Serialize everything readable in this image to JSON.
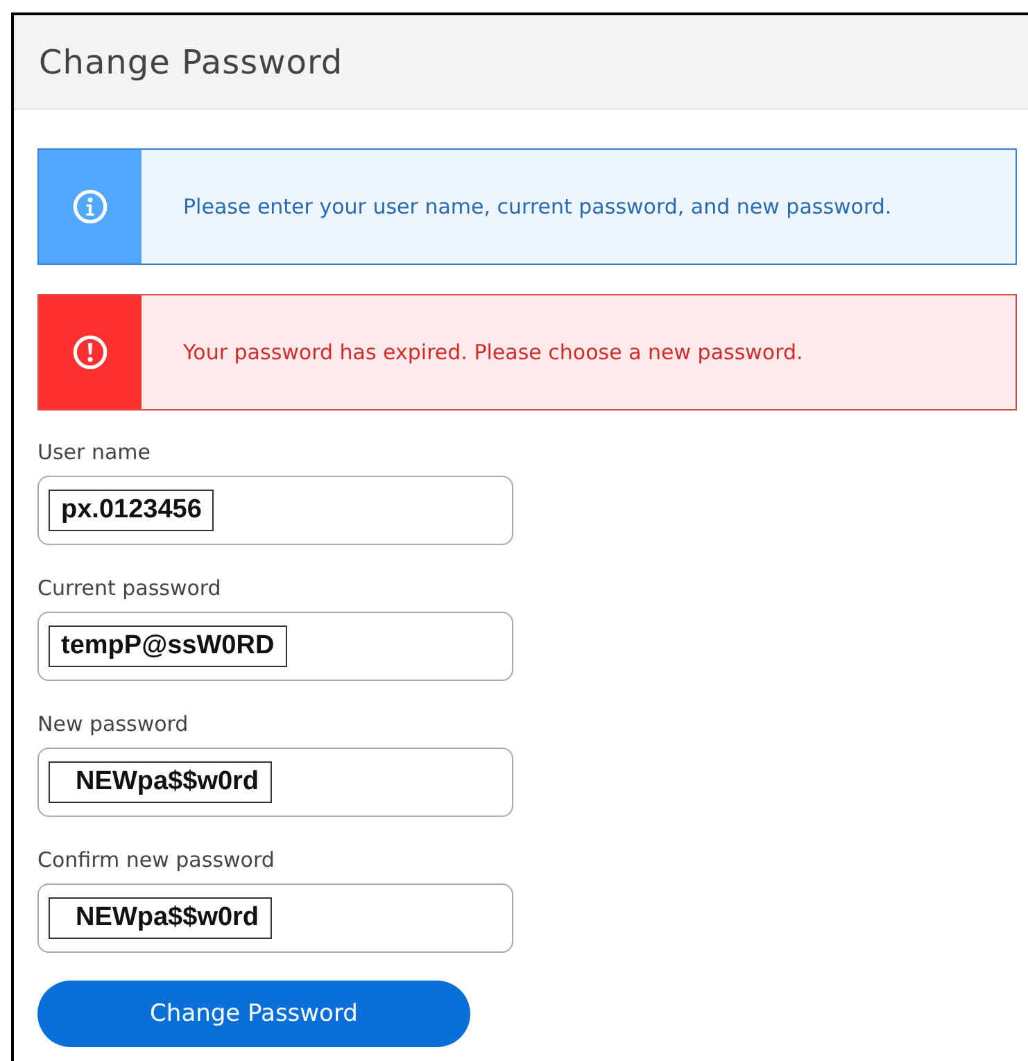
{
  "window": {
    "title": "Change Password"
  },
  "alerts": [
    {
      "kind": "info",
      "message": "Please enter your user name, current password, and new password."
    },
    {
      "kind": "error",
      "message": "Your password has expired. Please choose a new password."
    }
  ],
  "fields": [
    {
      "label": "User name",
      "value": "px.0123456"
    },
    {
      "label": "Current password",
      "value": "tempP@ssW0RD"
    },
    {
      "label": "New password",
      "value": "  NEWpa$$w0rd"
    },
    {
      "label": "Confirm new password",
      "value": "  NEWpa$$w0rd"
    }
  ],
  "submit": {
    "label": "Change Password"
  }
}
